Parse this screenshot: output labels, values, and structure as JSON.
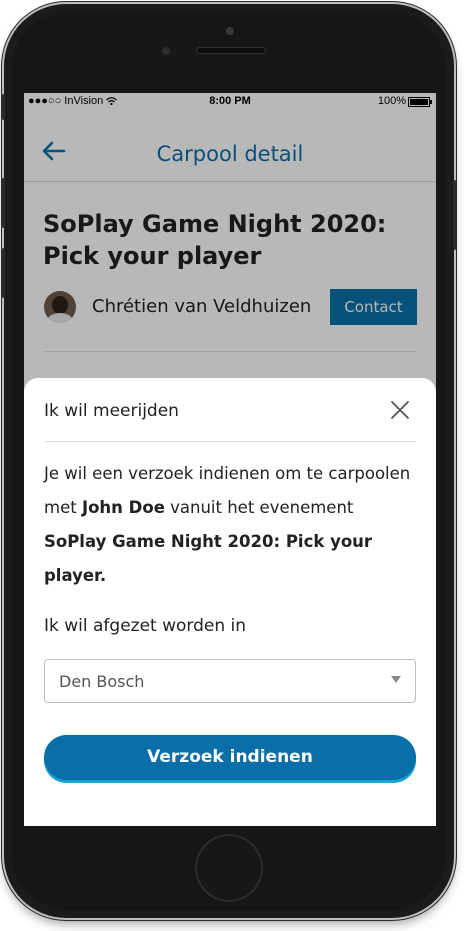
{
  "status_bar": {
    "carrier": "●●●○○ InVision",
    "wifi_icon": "wifi-icon",
    "time": "8:00 PM",
    "battery_percent": "100%"
  },
  "nav": {
    "back_icon": "arrow-left-icon",
    "title": "Carpool detail"
  },
  "event": {
    "title_line1": "SoPlay Game Night 2020:",
    "title_line2": "Pick your player",
    "organizer_name": "Chrétien van Veldhuizen",
    "contact_label": "Contact"
  },
  "sheet": {
    "title": "Ik wil meerijden",
    "close_icon": "close-icon",
    "desc_part1": "Je wil een verzoek indienen om te carpoolen met ",
    "desc_driver": "John Doe",
    "desc_part2": " vanuit het evenement ",
    "desc_event": "SoPlay Game Night 2020: Pick your player.",
    "dropoff_label": "Ik wil afgezet worden in",
    "dropoff_selected": "Den Bosch",
    "submit_label": "Verzoek indienen"
  },
  "colors": {
    "primary": "#0a6fa8",
    "accent_underline": "#13a3d6",
    "overlay": "rgba(0,0,0,0.28)"
  }
}
